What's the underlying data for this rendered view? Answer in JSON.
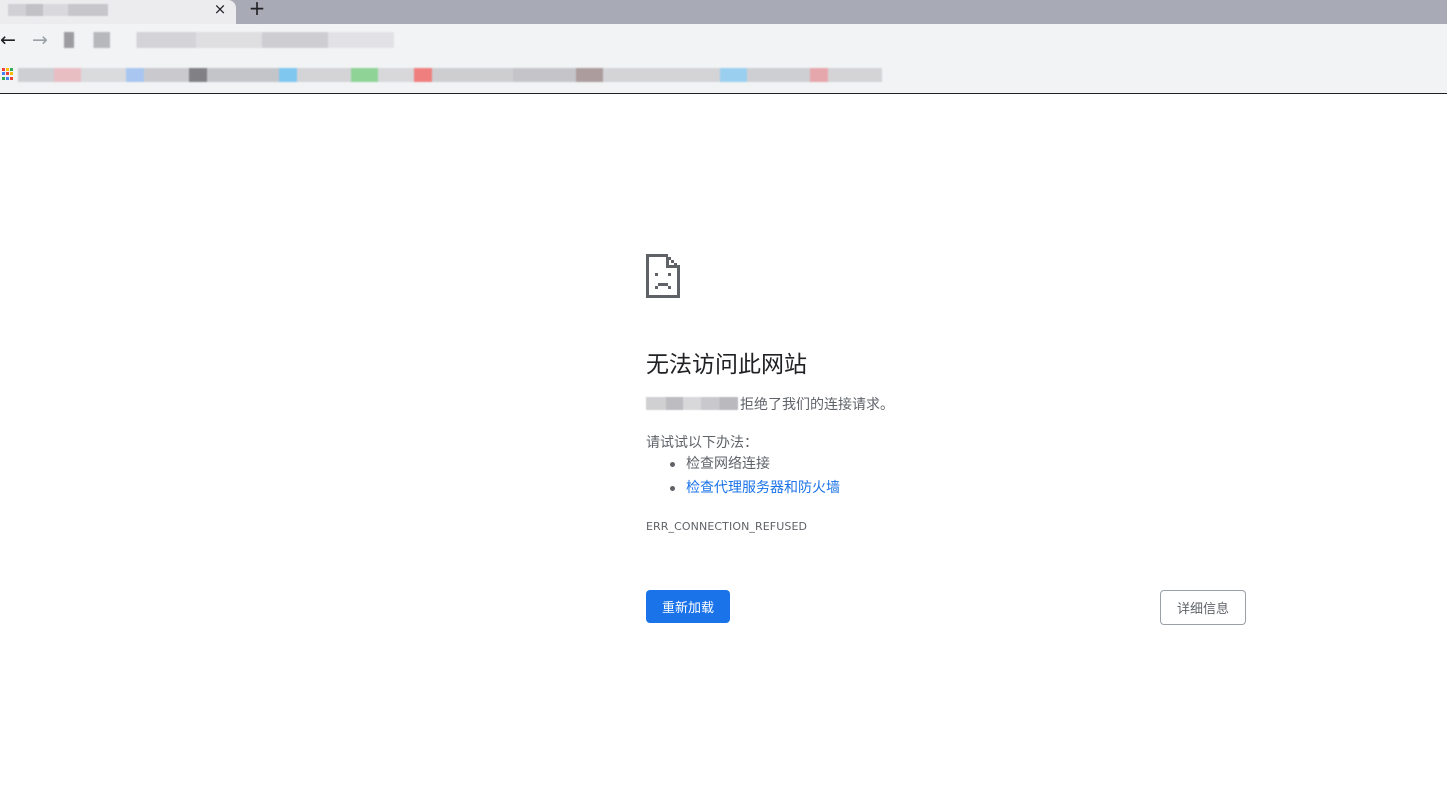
{
  "browser": {
    "tab_close_glyph": "×",
    "new_tab_glyph": "+",
    "back_glyph": "←",
    "forward_glyph": "→"
  },
  "error_page": {
    "heading": "无法访问此网站",
    "host_message": "拒绝了我们的连接请求。",
    "suggestions_title": "请试试以下办法：",
    "suggestions": [
      {
        "label": "检查网络连接",
        "is_link": false
      },
      {
        "label": "检查代理服务器和防火墙",
        "is_link": true
      }
    ],
    "error_code": "ERR_CONNECTION_REFUSED",
    "reload_label": "重新加载",
    "details_label": "详细信息"
  },
  "colors": {
    "primary_button": "#1a73e8",
    "link": "#1a73e8",
    "secondary_text": "#5f6368",
    "heading_text": "#202124"
  }
}
